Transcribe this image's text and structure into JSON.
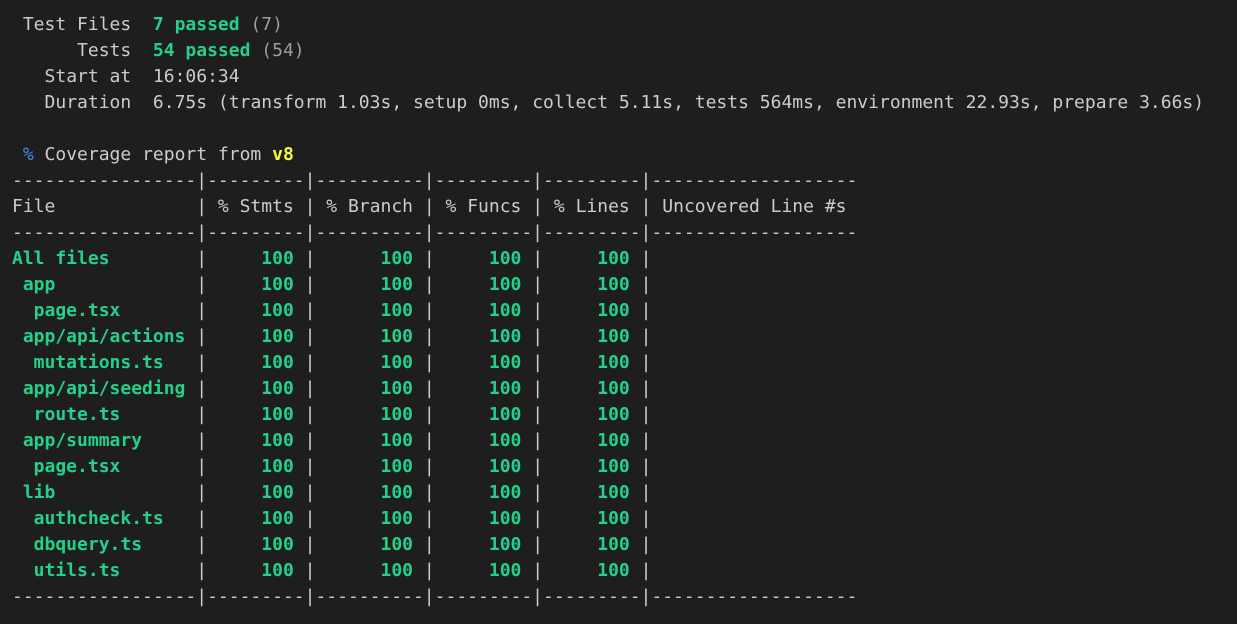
{
  "summary": {
    "test_files_label": "Test Files",
    "test_files_passed": "7 passed",
    "test_files_total": "(7)",
    "tests_label": "Tests",
    "tests_passed": "54 passed",
    "tests_total": "(54)",
    "start_label": "Start at",
    "start_value": "16:06:34",
    "duration_label": "Duration",
    "duration_value": "6.75s (transform 1.03s, setup 0ms, collect 5.11s, tests 564ms, environment 22.93s, prepare 3.66s)"
  },
  "coverage": {
    "percent_sign": "%",
    "report_text": "Coverage report from",
    "provider": "v8",
    "separator": "-----------------|---------|----------|---------|---------|-------------------",
    "headers": [
      "File",
      "% Stmts",
      "% Branch",
      "% Funcs",
      "% Lines",
      "Uncovered Line #s"
    ],
    "rows": [
      {
        "file": "All files",
        "indent": 0,
        "stmts": "100",
        "branch": "100",
        "funcs": "100",
        "lines": "100",
        "uncovered": ""
      },
      {
        "file": "app",
        "indent": 1,
        "stmts": "100",
        "branch": "100",
        "funcs": "100",
        "lines": "100",
        "uncovered": ""
      },
      {
        "file": "page.tsx",
        "indent": 2,
        "stmts": "100",
        "branch": "100",
        "funcs": "100",
        "lines": "100",
        "uncovered": ""
      },
      {
        "file": "app/api/actions",
        "indent": 1,
        "stmts": "100",
        "branch": "100",
        "funcs": "100",
        "lines": "100",
        "uncovered": ""
      },
      {
        "file": "mutations.ts",
        "indent": 2,
        "stmts": "100",
        "branch": "100",
        "funcs": "100",
        "lines": "100",
        "uncovered": ""
      },
      {
        "file": "app/api/seeding",
        "indent": 1,
        "stmts": "100",
        "branch": "100",
        "funcs": "100",
        "lines": "100",
        "uncovered": ""
      },
      {
        "file": "route.ts",
        "indent": 2,
        "stmts": "100",
        "branch": "100",
        "funcs": "100",
        "lines": "100",
        "uncovered": ""
      },
      {
        "file": "app/summary",
        "indent": 1,
        "stmts": "100",
        "branch": "100",
        "funcs": "100",
        "lines": "100",
        "uncovered": ""
      },
      {
        "file": "page.tsx",
        "indent": 2,
        "stmts": "100",
        "branch": "100",
        "funcs": "100",
        "lines": "100",
        "uncovered": ""
      },
      {
        "file": "lib",
        "indent": 1,
        "stmts": "100",
        "branch": "100",
        "funcs": "100",
        "lines": "100",
        "uncovered": ""
      },
      {
        "file": "authcheck.ts",
        "indent": 2,
        "stmts": "100",
        "branch": "100",
        "funcs": "100",
        "lines": "100",
        "uncovered": ""
      },
      {
        "file": "dbquery.ts",
        "indent": 2,
        "stmts": "100",
        "branch": "100",
        "funcs": "100",
        "lines": "100",
        "uncovered": ""
      },
      {
        "file": "utils.ts",
        "indent": 2,
        "stmts": "100",
        "branch": "100",
        "funcs": "100",
        "lines": "100",
        "uncovered": ""
      }
    ]
  },
  "colors": {
    "background": "#1e1e1e",
    "text": "#cccccc",
    "pass_green": "#23d18b",
    "dim": "#9d9d9d",
    "blue": "#3b8eea",
    "yellow": "#f5f543"
  }
}
